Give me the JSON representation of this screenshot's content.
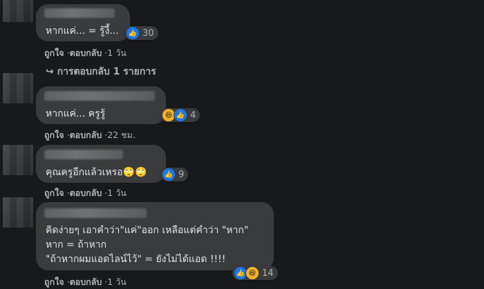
{
  "comments": [
    {
      "lines": [
        "หากแค่... = รู้งี้..."
      ],
      "reaction_icons": [
        "like-icon"
      ],
      "reaction_count": "30",
      "actions": {
        "like": "ถูกใจ",
        "reply": "ตอบกลับ",
        "time": "1 วัน"
      }
    },
    {
      "lines": [
        "หากแค่... ครูรู้"
      ],
      "reaction_icons": [
        "haha-icon",
        "like-icon"
      ],
      "reaction_count": "4",
      "actions": {
        "like": "ถูกใจ",
        "reply": "ตอบกลับ",
        "time": "22 ชม."
      }
    },
    {
      "lines": [
        "คุณครูอีกแล้วเหรอ🙄🙄"
      ],
      "reaction_icons": [
        "like-icon"
      ],
      "reaction_count": "9",
      "actions": {
        "like": "ถูกใจ",
        "reply": "ตอบกลับ",
        "time": "1 วัน"
      }
    },
    {
      "lines": [
        "คิดง่ายๆ เอาคำว่า\"แค่\"ออก เหลือแต่คำว่า \"หาก\"",
        "หาก = ถ้าหาก",
        "\"ถ้าหากผมแอดไลน์ไว้\" = ยังไม่ได้แอด !!!!"
      ],
      "reaction_icons": [
        "like-icon",
        "haha-icon"
      ],
      "reaction_count": "14",
      "actions": {
        "like": "ถูกใจ",
        "reply": "ตอบกลับ",
        "time": "1 วัน"
      }
    }
  ],
  "replies_link": "↪ การตอบกลับ 1 รายการ",
  "separator": "·",
  "colors": {
    "background": "#18191a",
    "bubble": "#3a3b3c",
    "text": "#e4e6eb",
    "muted": "#b0b3b8",
    "like": "#1877f2"
  }
}
